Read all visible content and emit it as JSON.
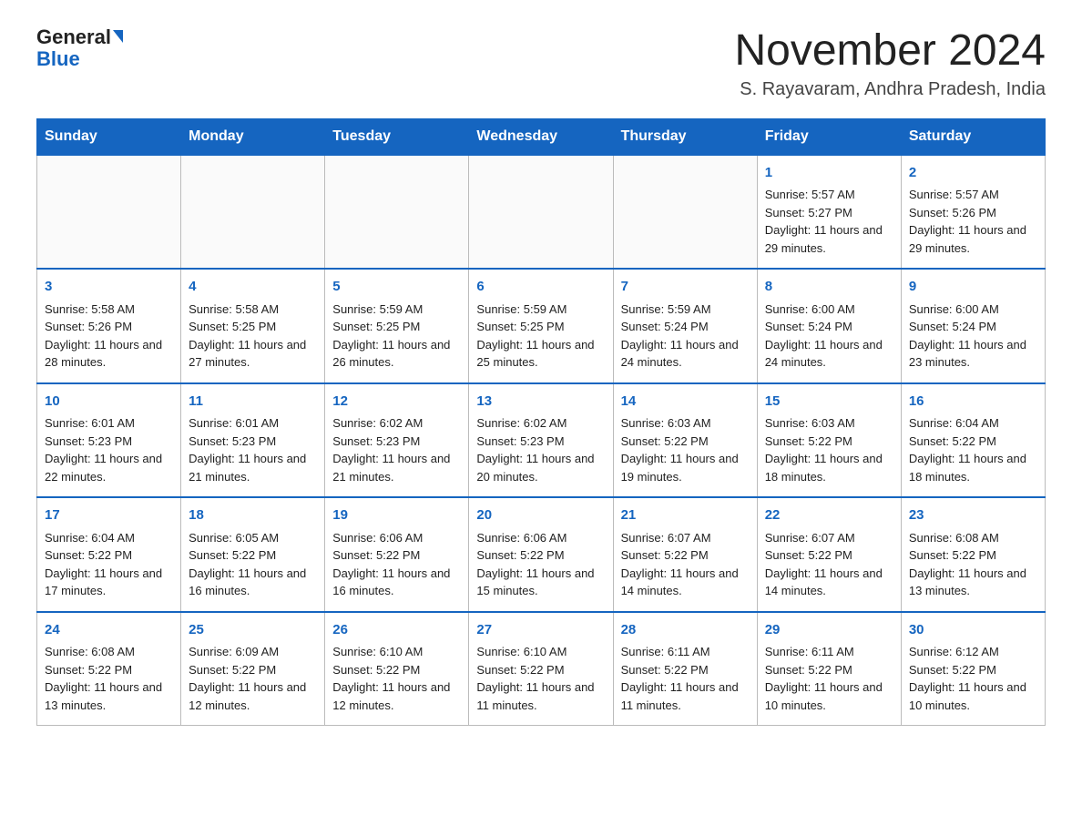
{
  "header": {
    "logo_general": "General",
    "logo_blue": "Blue",
    "month_title": "November 2024",
    "location": "S. Rayavaram, Andhra Pradesh, India"
  },
  "weekdays": [
    "Sunday",
    "Monday",
    "Tuesday",
    "Wednesday",
    "Thursday",
    "Friday",
    "Saturday"
  ],
  "weeks": [
    [
      {
        "day": "",
        "sunrise": "",
        "sunset": "",
        "daylight": ""
      },
      {
        "day": "",
        "sunrise": "",
        "sunset": "",
        "daylight": ""
      },
      {
        "day": "",
        "sunrise": "",
        "sunset": "",
        "daylight": ""
      },
      {
        "day": "",
        "sunrise": "",
        "sunset": "",
        "daylight": ""
      },
      {
        "day": "",
        "sunrise": "",
        "sunset": "",
        "daylight": ""
      },
      {
        "day": "1",
        "sunrise": "Sunrise: 5:57 AM",
        "sunset": "Sunset: 5:27 PM",
        "daylight": "Daylight: 11 hours and 29 minutes."
      },
      {
        "day": "2",
        "sunrise": "Sunrise: 5:57 AM",
        "sunset": "Sunset: 5:26 PM",
        "daylight": "Daylight: 11 hours and 29 minutes."
      }
    ],
    [
      {
        "day": "3",
        "sunrise": "Sunrise: 5:58 AM",
        "sunset": "Sunset: 5:26 PM",
        "daylight": "Daylight: 11 hours and 28 minutes."
      },
      {
        "day": "4",
        "sunrise": "Sunrise: 5:58 AM",
        "sunset": "Sunset: 5:25 PM",
        "daylight": "Daylight: 11 hours and 27 minutes."
      },
      {
        "day": "5",
        "sunrise": "Sunrise: 5:59 AM",
        "sunset": "Sunset: 5:25 PM",
        "daylight": "Daylight: 11 hours and 26 minutes."
      },
      {
        "day": "6",
        "sunrise": "Sunrise: 5:59 AM",
        "sunset": "Sunset: 5:25 PM",
        "daylight": "Daylight: 11 hours and 25 minutes."
      },
      {
        "day": "7",
        "sunrise": "Sunrise: 5:59 AM",
        "sunset": "Sunset: 5:24 PM",
        "daylight": "Daylight: 11 hours and 24 minutes."
      },
      {
        "day": "8",
        "sunrise": "Sunrise: 6:00 AM",
        "sunset": "Sunset: 5:24 PM",
        "daylight": "Daylight: 11 hours and 24 minutes."
      },
      {
        "day": "9",
        "sunrise": "Sunrise: 6:00 AM",
        "sunset": "Sunset: 5:24 PM",
        "daylight": "Daylight: 11 hours and 23 minutes."
      }
    ],
    [
      {
        "day": "10",
        "sunrise": "Sunrise: 6:01 AM",
        "sunset": "Sunset: 5:23 PM",
        "daylight": "Daylight: 11 hours and 22 minutes."
      },
      {
        "day": "11",
        "sunrise": "Sunrise: 6:01 AM",
        "sunset": "Sunset: 5:23 PM",
        "daylight": "Daylight: 11 hours and 21 minutes."
      },
      {
        "day": "12",
        "sunrise": "Sunrise: 6:02 AM",
        "sunset": "Sunset: 5:23 PM",
        "daylight": "Daylight: 11 hours and 21 minutes."
      },
      {
        "day": "13",
        "sunrise": "Sunrise: 6:02 AM",
        "sunset": "Sunset: 5:23 PM",
        "daylight": "Daylight: 11 hours and 20 minutes."
      },
      {
        "day": "14",
        "sunrise": "Sunrise: 6:03 AM",
        "sunset": "Sunset: 5:22 PM",
        "daylight": "Daylight: 11 hours and 19 minutes."
      },
      {
        "day": "15",
        "sunrise": "Sunrise: 6:03 AM",
        "sunset": "Sunset: 5:22 PM",
        "daylight": "Daylight: 11 hours and 18 minutes."
      },
      {
        "day": "16",
        "sunrise": "Sunrise: 6:04 AM",
        "sunset": "Sunset: 5:22 PM",
        "daylight": "Daylight: 11 hours and 18 minutes."
      }
    ],
    [
      {
        "day": "17",
        "sunrise": "Sunrise: 6:04 AM",
        "sunset": "Sunset: 5:22 PM",
        "daylight": "Daylight: 11 hours and 17 minutes."
      },
      {
        "day": "18",
        "sunrise": "Sunrise: 6:05 AM",
        "sunset": "Sunset: 5:22 PM",
        "daylight": "Daylight: 11 hours and 16 minutes."
      },
      {
        "day": "19",
        "sunrise": "Sunrise: 6:06 AM",
        "sunset": "Sunset: 5:22 PM",
        "daylight": "Daylight: 11 hours and 16 minutes."
      },
      {
        "day": "20",
        "sunrise": "Sunrise: 6:06 AM",
        "sunset": "Sunset: 5:22 PM",
        "daylight": "Daylight: 11 hours and 15 minutes."
      },
      {
        "day": "21",
        "sunrise": "Sunrise: 6:07 AM",
        "sunset": "Sunset: 5:22 PM",
        "daylight": "Daylight: 11 hours and 14 minutes."
      },
      {
        "day": "22",
        "sunrise": "Sunrise: 6:07 AM",
        "sunset": "Sunset: 5:22 PM",
        "daylight": "Daylight: 11 hours and 14 minutes."
      },
      {
        "day": "23",
        "sunrise": "Sunrise: 6:08 AM",
        "sunset": "Sunset: 5:22 PM",
        "daylight": "Daylight: 11 hours and 13 minutes."
      }
    ],
    [
      {
        "day": "24",
        "sunrise": "Sunrise: 6:08 AM",
        "sunset": "Sunset: 5:22 PM",
        "daylight": "Daylight: 11 hours and 13 minutes."
      },
      {
        "day": "25",
        "sunrise": "Sunrise: 6:09 AM",
        "sunset": "Sunset: 5:22 PM",
        "daylight": "Daylight: 11 hours and 12 minutes."
      },
      {
        "day": "26",
        "sunrise": "Sunrise: 6:10 AM",
        "sunset": "Sunset: 5:22 PM",
        "daylight": "Daylight: 11 hours and 12 minutes."
      },
      {
        "day": "27",
        "sunrise": "Sunrise: 6:10 AM",
        "sunset": "Sunset: 5:22 PM",
        "daylight": "Daylight: 11 hours and 11 minutes."
      },
      {
        "day": "28",
        "sunrise": "Sunrise: 6:11 AM",
        "sunset": "Sunset: 5:22 PM",
        "daylight": "Daylight: 11 hours and 11 minutes."
      },
      {
        "day": "29",
        "sunrise": "Sunrise: 6:11 AM",
        "sunset": "Sunset: 5:22 PM",
        "daylight": "Daylight: 11 hours and 10 minutes."
      },
      {
        "day": "30",
        "sunrise": "Sunrise: 6:12 AM",
        "sunset": "Sunset: 5:22 PM",
        "daylight": "Daylight: 11 hours and 10 minutes."
      }
    ]
  ]
}
